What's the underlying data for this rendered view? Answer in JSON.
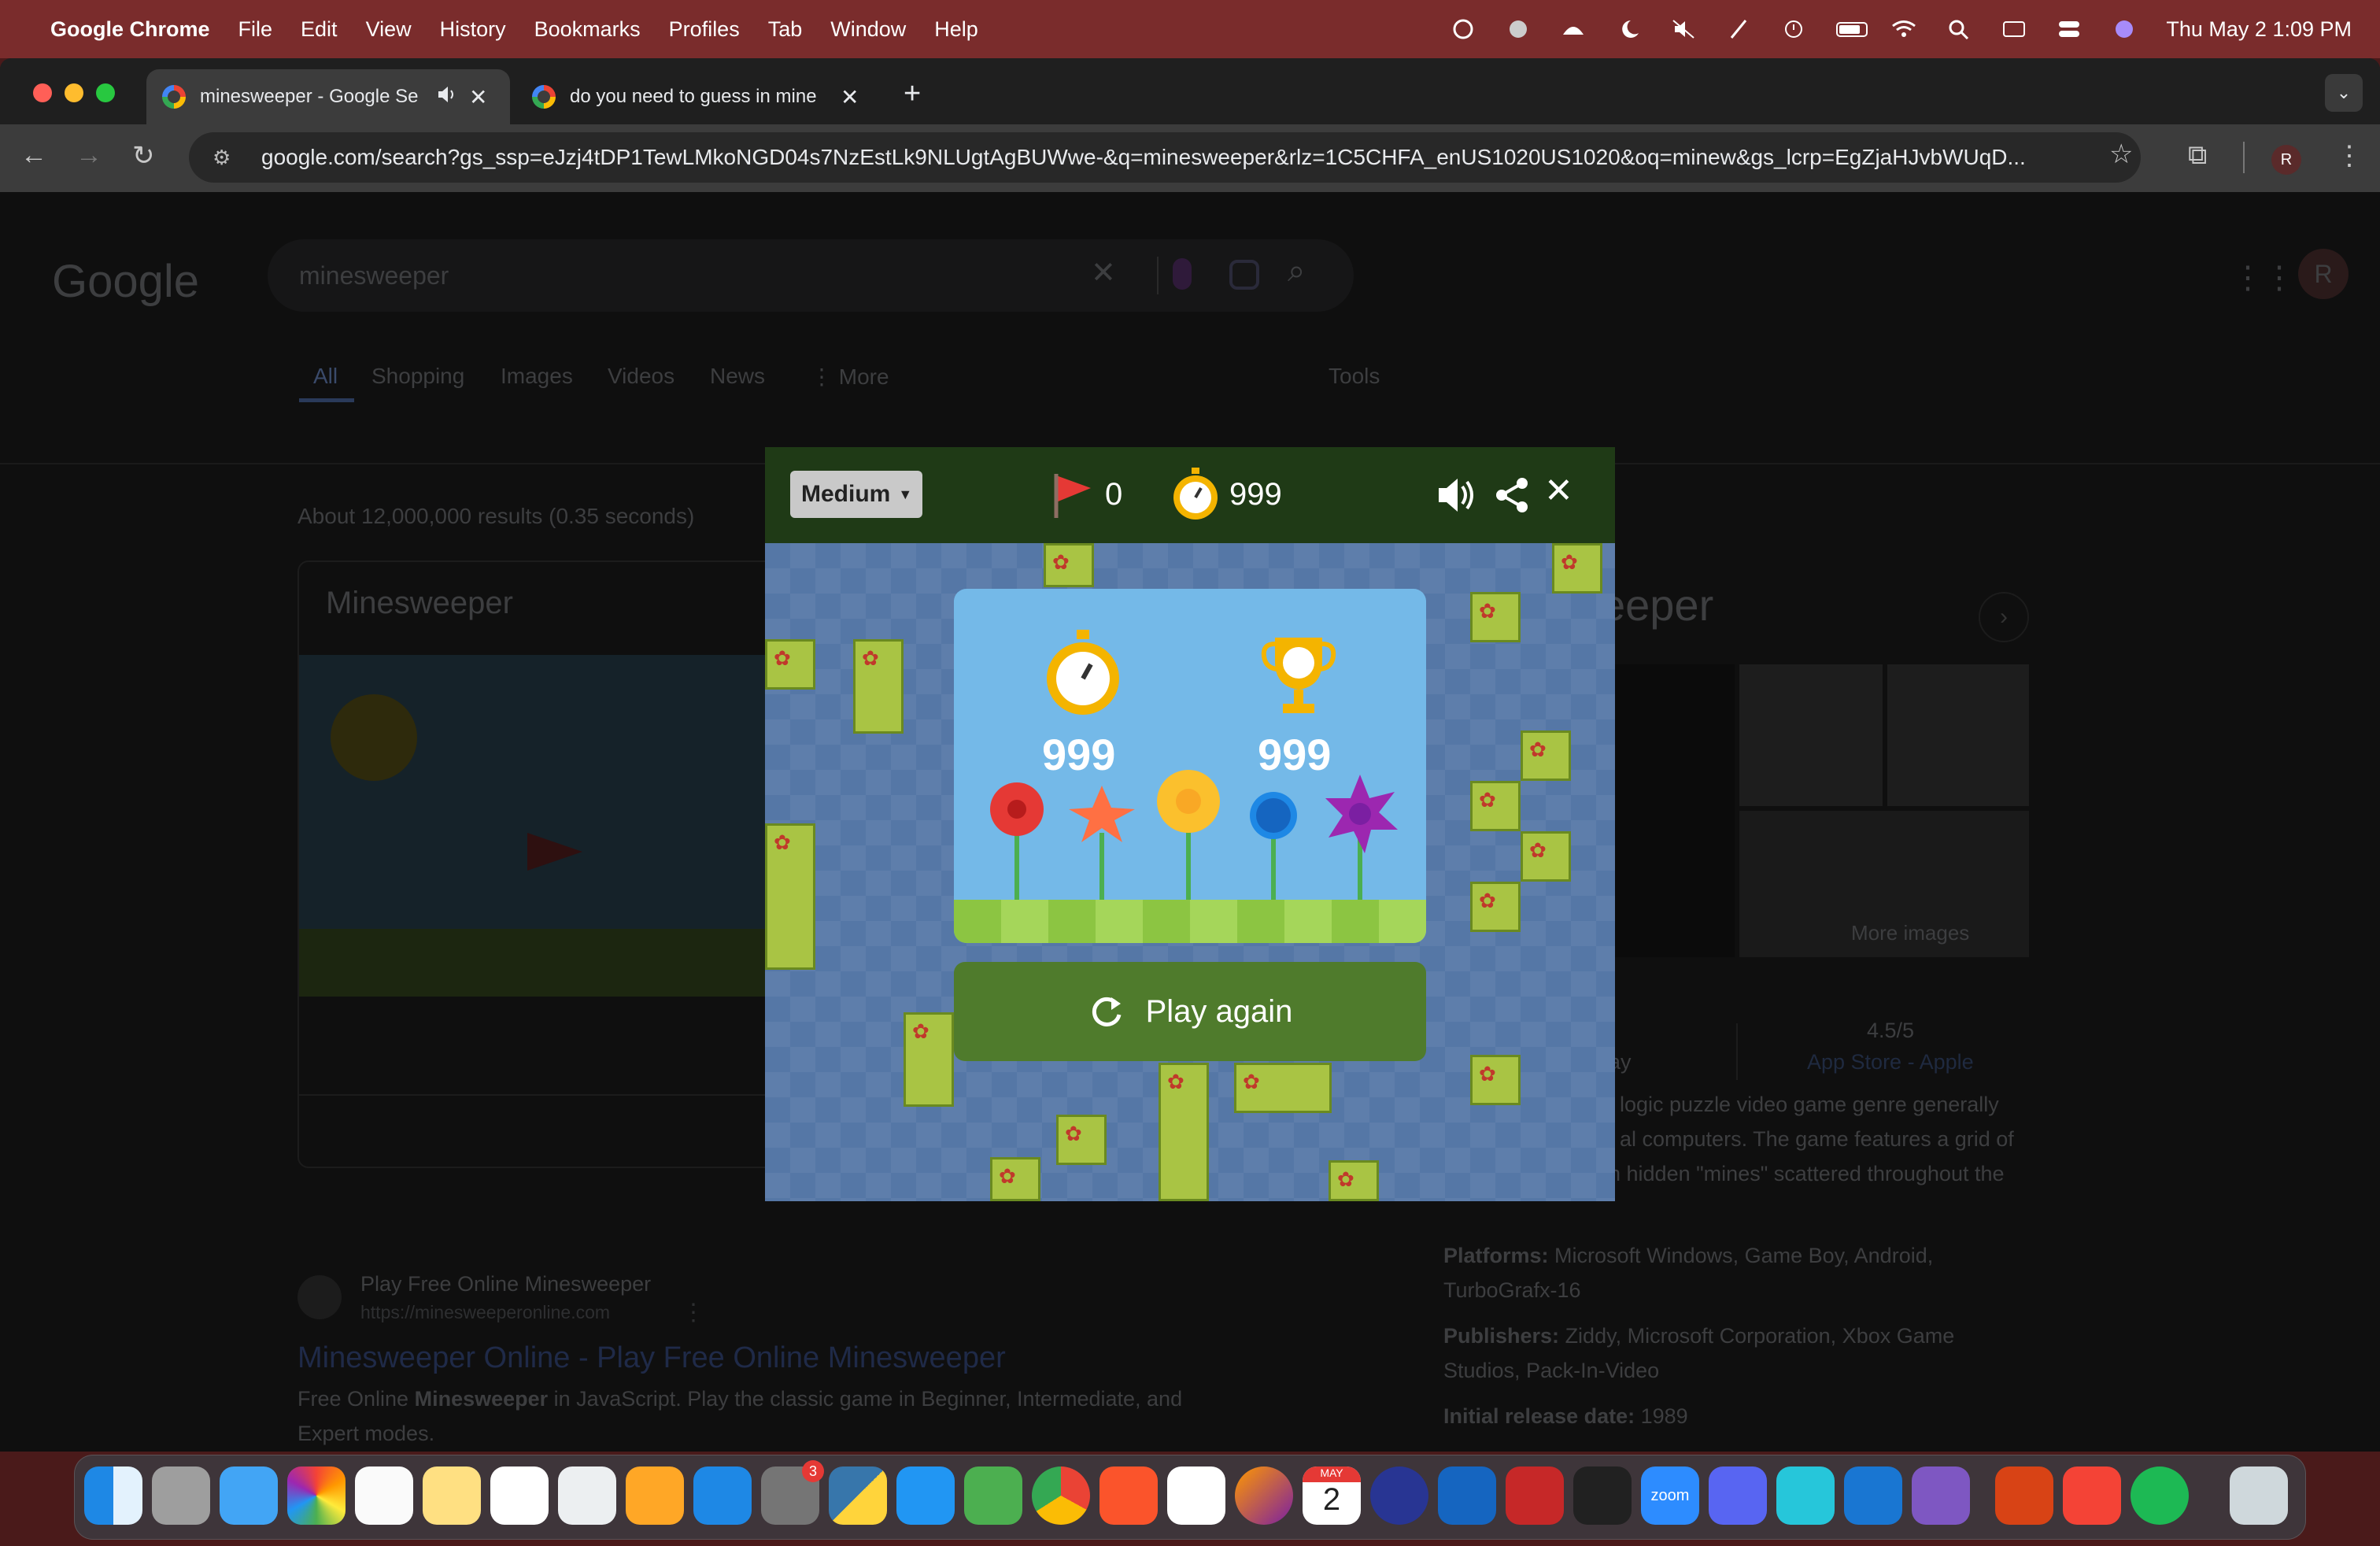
{
  "menubar": {
    "app": "Google Chrome",
    "items": [
      "File",
      "Edit",
      "View",
      "History",
      "Bookmarks",
      "Profiles",
      "Tab",
      "Window",
      "Help"
    ],
    "clock": "Thu May 2  1:09 PM"
  },
  "tabs": [
    {
      "title": "minesweeper - Google Se"
    },
    {
      "title": "do you need to guess in mine"
    }
  ],
  "toolbar": {
    "url": "google.com/search?gs_ssp=eJzj4tDP1TewLMkoNGD04s7NzEstLk9NLUgtAgBUWwe-&q=minesweeper&rlz=1C5CHFA_enUS1020US1020&oq=minew&gs_lcrp=EgZjaHJvbWUqD...",
    "profile": "R"
  },
  "search": {
    "logo": "Google",
    "query": "minesweeper",
    "avatar": "R",
    "tabs": [
      "All",
      "Shopping",
      "Images",
      "Videos",
      "News",
      "More"
    ],
    "tools": "Tools",
    "results_count": "About 12,000,000 results (0.35 seconds)",
    "card_title": "Minesweeper",
    "kp_title_frag": "eeper",
    "more_images": "More images",
    "rating": "4.5/5",
    "rating_source": "App Store - Apple",
    "rating_frag": "ay",
    "desc_lines": [
      "logic puzzle video game genre generally",
      "al computers. The game features a grid of",
      "h hidden \"mines\" scattered throughout the"
    ],
    "platforms_label": "Platforms:",
    "platforms_value": "Microsoft Windows, Game Boy, Android,",
    "platforms_value2": "TurboGrafx-16",
    "publishers_label": "Publishers:",
    "publishers_value": "Ziddy, Microsoft Corporation, Xbox Game",
    "publishers_value2": "Studios, Pack-In-Video",
    "release_label": "Initial release date:",
    "release_value": "1989",
    "result1_site": "Play Free Online Minesweeper",
    "result1_url": "https://minesweeperonline.com",
    "result1_title": "Minesweeper Online - Play Free Online Minesweeper",
    "result1_snip_a": "Free Online ",
    "result1_snip_b": "Minesweeper",
    "result1_snip_c": " in JavaScript. Play the classic game in Beginner, Intermediate, and",
    "result1_snip2": "Expert modes."
  },
  "game": {
    "difficulty": "Medium",
    "flags": "0",
    "timer": "999",
    "time_score": "999",
    "best_score": "999",
    "play_again": "Play again"
  },
  "dock": {
    "settings_badge": "3",
    "calendar_month": "MAY",
    "calendar_day": "2",
    "zoom_label": "zoom"
  }
}
